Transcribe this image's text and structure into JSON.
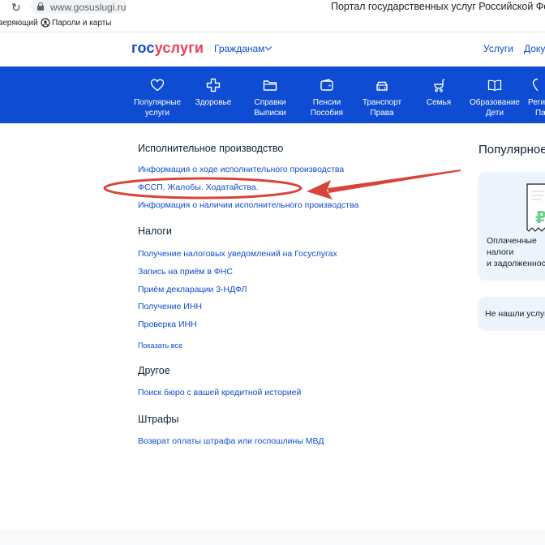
{
  "browser": {
    "url": "www.gosuslugi.ru",
    "tab_title": "Портал государственных услуг Российской Федерации",
    "bookmark_left": "веряющий",
    "bookmark_passwords": "Пароли и карты"
  },
  "header": {
    "logo_part1": "гос",
    "logo_part2": "услуги",
    "citizens": "Гражданам",
    "services": "Услуги",
    "documents": "Документы"
  },
  "categories": [
    {
      "line1": "Популярные",
      "line2": "услуги"
    },
    {
      "line1": "Здоровье",
      "line2": ""
    },
    {
      "line1": "Справки",
      "line2": "Выписки"
    },
    {
      "line1": "Пенсии",
      "line2": "Пособия"
    },
    {
      "line1": "Транспорт",
      "line2": "Права"
    },
    {
      "line1": "Семья",
      "line2": ""
    },
    {
      "line1": "Образование",
      "line2": "Дети"
    },
    {
      "line1": "Регион",
      "line2": "Па"
    }
  ],
  "sections": {
    "enforcement": {
      "title": "Исполнительное производство",
      "links": [
        "Информация о ходе исполнительного производства",
        "ФССП. Жалобы. Ходатайства.",
        "Информация о наличии исполнительного производства"
      ]
    },
    "taxes": {
      "title": "Налоги",
      "links": [
        "Получение налоговых уведомлений на Госуслугах",
        "Запись на приём в ФНС",
        "Приём декларации 3-НДФЛ",
        "Получение ИНН",
        "Проверка ИНН"
      ],
      "show_all": "Показать все"
    },
    "other": {
      "title": "Другое",
      "links": [
        "Поиск бюро с вашей кредитной историей"
      ]
    },
    "fines": {
      "title": "Штрафы",
      "links": [
        "Возврат оплаты штрафа или госпошлины МВД"
      ]
    }
  },
  "sidebar": {
    "popular_title": "Популярное",
    "paid_card": {
      "line1": "Оплаченные",
      "line2": "налоги",
      "line3": "и задолженность"
    },
    "not_found": "Не нашли услугу?"
  },
  "colors": {
    "brand_blue": "#0d4cd3",
    "brand_red": "#ee3f58",
    "annotation_red": "#d9443a",
    "card_bg": "#eef4fb"
  }
}
